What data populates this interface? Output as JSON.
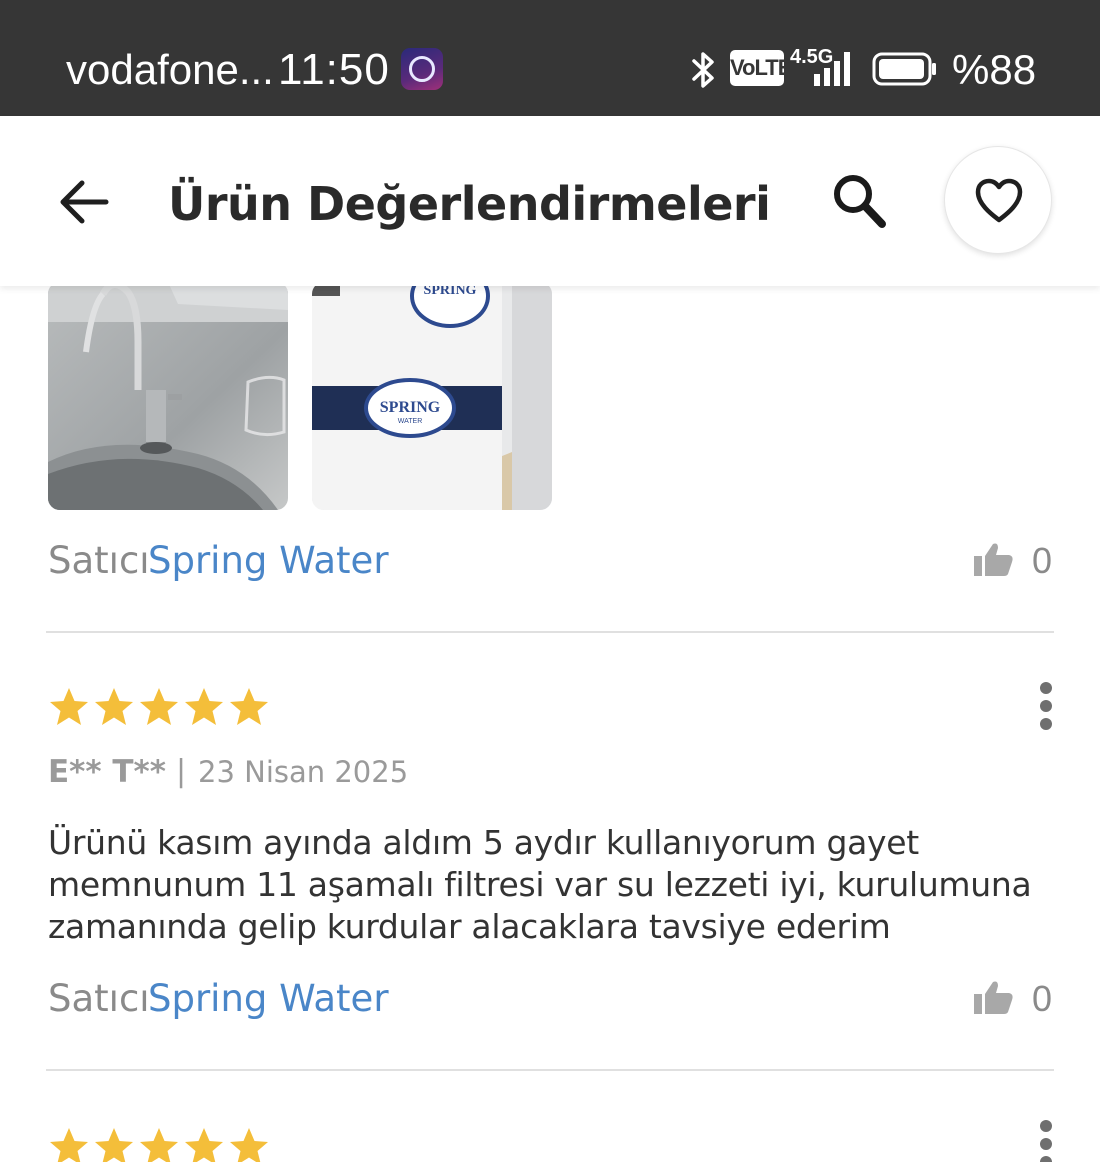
{
  "status_bar": {
    "carrier": "vodafone...",
    "time": "11:50",
    "volte": "VoLTE",
    "network": "4.5G",
    "battery": "%88"
  },
  "app_bar": {
    "title": "Ürün Değerlendirmeleri"
  },
  "reviews": [
    {
      "photos": [
        "faucet-photo",
        "water-filter-photo"
      ],
      "seller_prefix": "Satıcı",
      "seller_name": "Spring Water",
      "likes": "0"
    },
    {
      "rating": 5,
      "reviewer": "E** T**",
      "separator": "|",
      "date": "23 Nisan 2025",
      "text": "Ürünü kasım ayında aldım 5 aydır kullanıyorum gayet memnunum 11 aşamalı filtresi var su lezzeti iyi, kurulumuna zamanında gelip kurdular alacaklara tavsiye ederim",
      "seller_prefix": "Satıcı",
      "seller_name": "Spring Water",
      "likes": "0"
    },
    {
      "rating": 5
    }
  ],
  "colors": {
    "status_bar_bg": "#363636",
    "star": "#f4be3a",
    "seller_link": "#4a86c8",
    "muted_text": "#8a8a8a"
  },
  "icons": {
    "back": "arrow-left-icon",
    "search": "search-icon",
    "favorite": "heart-icon",
    "like": "thumbs-up-icon",
    "more": "more-vertical-icon",
    "star": "star-icon"
  }
}
